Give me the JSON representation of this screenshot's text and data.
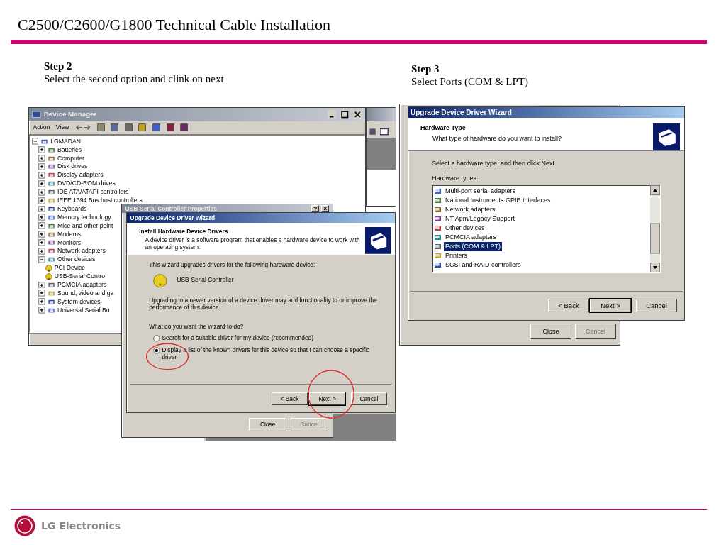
{
  "title": "C2500/C2600/G1800 Technical Cable Installation",
  "step_2": {
    "heading": "Step 2",
    "instruction": "Select the second option and clink on next",
    "device_manager": {
      "title": "Device Manager",
      "menu": [
        "Action",
        "View"
      ],
      "tree": [
        {
          "label": "LGMADAN",
          "expanded": true,
          "children": [
            {
              "label": "Batteries",
              "expanded": false
            },
            {
              "label": "Computer",
              "expanded": false
            },
            {
              "label": "Disk drives",
              "expanded": false
            },
            {
              "label": "Display adapters",
              "expanded": false
            },
            {
              "label": "DVD/CD-ROM drives",
              "expanded": false
            },
            {
              "label": "IDE ATA/ATAPI controllers",
              "expanded": false
            },
            {
              "label": "IEEE 1394 Bus host controllers",
              "expanded": false
            },
            {
              "label": "Keyboards",
              "expanded": false
            },
            {
              "label": "Memory technology",
              "expanded": false
            },
            {
              "label": "Mice and other point",
              "expanded": false
            },
            {
              "label": "Modems",
              "expanded": false
            },
            {
              "label": "Monitors",
              "expanded": false
            },
            {
              "label": "Network adapters",
              "expanded": false
            },
            {
              "label": "Other devices",
              "expanded": true,
              "children": [
                {
                  "label": "PCI Device"
                },
                {
                  "label": "USB-Serial Contro"
                }
              ]
            },
            {
              "label": "PCMCIA adapters",
              "expanded": false
            },
            {
              "label": "Sound, video and ga",
              "expanded": false
            },
            {
              "label": "System devices",
              "expanded": false
            },
            {
              "label": "Universal Serial Bu",
              "expanded": false
            }
          ]
        }
      ]
    },
    "properties_dialog": {
      "title": "USB-Serial Controller Properties",
      "title_buttons": [
        "?",
        "×"
      ],
      "buttons": [
        {
          "label": "Close",
          "disabled": false
        },
        {
          "label": "Cancel",
          "disabled": true
        }
      ]
    },
    "wizard": {
      "title": "Upgrade Device Driver Wizard",
      "header": "Install Hardware Device Drivers",
      "subheader": "A device driver is a software program that enables a hardware device to work with an operating system.",
      "intro": "This wizard upgrades drivers for the following hardware device:",
      "device": "USB-Serial Controller",
      "note": "Upgrading to a newer version of a device driver may add functionality to or improve the performance of this device.",
      "question": "What do you want the wizard to do?",
      "options": [
        {
          "label": "Search for a suitable driver for my device (recommended)",
          "selected": false
        },
        {
          "label": "Display a list of the known drivers for this device so that I can choose a specific driver",
          "selected": true
        }
      ],
      "buttons": [
        {
          "label": "< Back",
          "default": false
        },
        {
          "label": "Next >",
          "default": true
        },
        {
          "label": "Cancel",
          "default": false
        }
      ]
    }
  },
  "step_3": {
    "heading": "Step 3",
    "instruction": "Select Ports (COM & LPT)",
    "background_window": {
      "buttons": [
        {
          "label": "Close",
          "disabled": false
        },
        {
          "label": "Cancel",
          "disabled": true
        }
      ]
    },
    "wizard": {
      "title": "Upgrade Device Driver Wizard",
      "header": "Hardware Type",
      "subheader": "What type of hardware do you want to install?",
      "prompt": "Select a hardware type, and then click Next.",
      "list_label": "Hardware types:",
      "items": [
        {
          "label": "Multi-port serial adapters",
          "selected": false
        },
        {
          "label": "National Instruments GPIB Interfaces",
          "selected": false
        },
        {
          "label": "Network adapters",
          "selected": false
        },
        {
          "label": "NT Apm/Legacy Support",
          "selected": false
        },
        {
          "label": "Other devices",
          "selected": false
        },
        {
          "label": "PCMCIA adapters",
          "selected": false
        },
        {
          "label": "Ports (COM & LPT)",
          "selected": true
        },
        {
          "label": "Printers",
          "selected": false
        },
        {
          "label": "SCSI and RAID controllers",
          "selected": false
        }
      ],
      "buttons": [
        {
          "label": "< Back",
          "default": false
        },
        {
          "label": "Next >",
          "default": true
        },
        {
          "label": "Cancel",
          "default": false
        }
      ]
    }
  },
  "footer": {
    "brand": "LG Electronics"
  }
}
